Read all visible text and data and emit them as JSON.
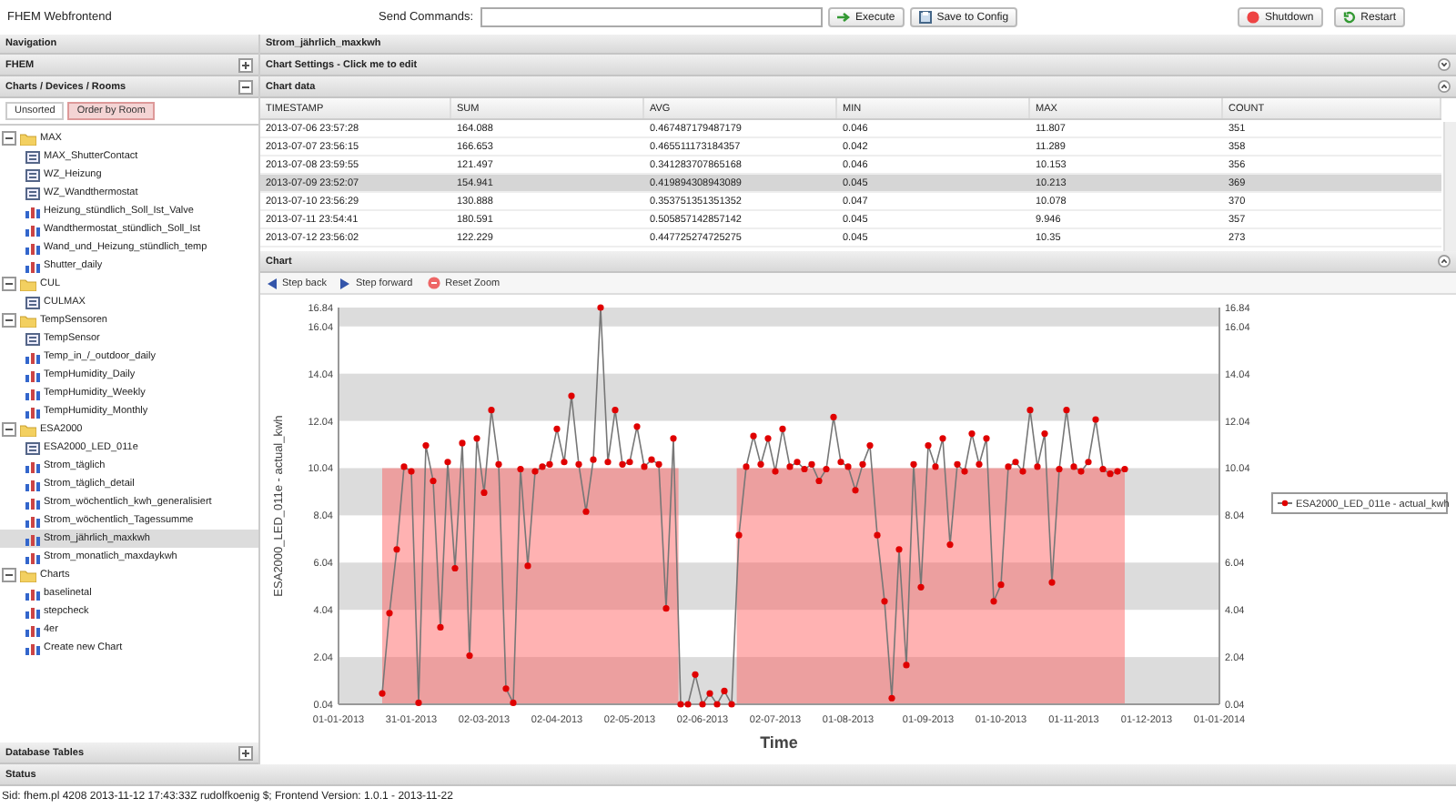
{
  "app": {
    "title": "FHEM Webfrontend"
  },
  "command": {
    "label": "Send Commands:",
    "buttons": [
      {
        "label": "Execute",
        "kind": "execute"
      },
      {
        "label": "Save to Config",
        "kind": "save"
      }
    ]
  },
  "power_buttons": [
    {
      "label": "Shutdown",
      "kind": "shutdown"
    },
    {
      "label": "Restart",
      "kind": "restart"
    }
  ],
  "navigation": {
    "title": "Navigation",
    "sections": [
      {
        "title": "FHEM",
        "expanded": false
      },
      {
        "title": "Charts / Devices / Rooms",
        "expanded": true
      }
    ],
    "tabs": [
      {
        "label": "Unsorted",
        "selected": false
      },
      {
        "label": "Order by Room",
        "selected": true
      }
    ],
    "tree": [
      {
        "label": "MAX",
        "expanded": true,
        "children": [
          {
            "label": "MAX_ShutterContact",
            "kind": "device",
            "selected": false
          },
          {
            "label": "WZ_Heizung",
            "kind": "device",
            "selected": false
          },
          {
            "label": "WZ_Wandthermostat",
            "kind": "device",
            "selected": false
          },
          {
            "label": "Heizung_stündlich_Soll_Ist_Valve",
            "kind": "chart",
            "selected": false
          },
          {
            "label": "Wandthermostat_stündlich_Soll_Ist",
            "kind": "chart",
            "selected": false
          },
          {
            "label": "Wand_und_Heizung_stündlich_temp",
            "kind": "chart",
            "selected": false
          },
          {
            "label": "Shutter_daily",
            "kind": "chart",
            "selected": false
          }
        ]
      },
      {
        "label": "CUL",
        "expanded": true,
        "children": [
          {
            "label": "CULMAX",
            "kind": "device",
            "selected": false
          }
        ]
      },
      {
        "label": "TempSensoren",
        "expanded": true,
        "children": [
          {
            "label": "TempSensor",
            "kind": "device",
            "selected": false
          },
          {
            "label": "Temp_in_/_outdoor_daily",
            "kind": "chart",
            "selected": false
          },
          {
            "label": "TempHumidity_Daily",
            "kind": "chart",
            "selected": false
          },
          {
            "label": "TempHumidity_Weekly",
            "kind": "chart",
            "selected": false
          },
          {
            "label": "TempHumidity_Monthly",
            "kind": "chart",
            "selected": false
          }
        ]
      },
      {
        "label": "ESA2000",
        "expanded": true,
        "children": [
          {
            "label": "ESA2000_LED_011e",
            "kind": "device",
            "selected": false
          },
          {
            "label": "Strom_täglich",
            "kind": "chart",
            "selected": false
          },
          {
            "label": "Strom_täglich_detail",
            "kind": "chart",
            "selected": false
          },
          {
            "label": "Strom_wöchentlich_kwh_generalisiert",
            "kind": "chart",
            "selected": false
          },
          {
            "label": "Strom_wöchentlich_Tagessumme",
            "kind": "chart",
            "selected": false
          },
          {
            "label": "Strom_jährlich_maxkwh",
            "kind": "chart",
            "selected": true
          },
          {
            "label": "Strom_monatlich_maxdaykwh",
            "kind": "chart",
            "selected": false
          }
        ]
      },
      {
        "label": "Charts",
        "expanded": true,
        "children": [
          {
            "label": "baselinetal",
            "kind": "chart",
            "selected": false
          },
          {
            "label": "stepcheck",
            "kind": "chart",
            "selected": false
          },
          {
            "label": "4er",
            "kind": "chart",
            "selected": false
          },
          {
            "label": "Create new Chart",
            "kind": "chart",
            "selected": false
          }
        ]
      }
    ],
    "footer": {
      "title": "Database Tables",
      "expanded": false
    }
  },
  "main": {
    "title": "Strom_jährlich_maxkwh",
    "settings": {
      "title": "Chart Settings - Click me to edit",
      "expanded": false
    },
    "data": {
      "title": "Chart data",
      "expanded": true,
      "columns": [
        "TIMESTAMP",
        "SUM",
        "AVG",
        "MIN",
        "MAX",
        "COUNT"
      ],
      "rows": [
        {
          "cells": [
            "2013-07-06 23:57:28",
            "164.088",
            "0.467487179487179",
            "0.046",
            "11.807",
            "351"
          ],
          "selected": false
        },
        {
          "cells": [
            "2013-07-07 23:56:15",
            "166.653",
            "0.465511173184357",
            "0.042",
            "11.289",
            "358"
          ],
          "selected": false
        },
        {
          "cells": [
            "2013-07-08 23:59:55",
            "121.497",
            "0.341283707865168",
            "0.046",
            "10.153",
            "356"
          ],
          "selected": false
        },
        {
          "cells": [
            "2013-07-09 23:52:07",
            "154.941",
            "0.419894308943089",
            "0.045",
            "10.213",
            "369"
          ],
          "selected": true
        },
        {
          "cells": [
            "2013-07-10 23:56:29",
            "130.888",
            "0.353751351351352",
            "0.047",
            "10.078",
            "370"
          ],
          "selected": false
        },
        {
          "cells": [
            "2013-07-11 23:54:41",
            "180.591",
            "0.505857142857142",
            "0.045",
            "9.946",
            "357"
          ],
          "selected": false
        },
        {
          "cells": [
            "2013-07-12 23:56:02",
            "122.229",
            "0.447725274725275",
            "0.045",
            "10.35",
            "273"
          ],
          "selected": false
        }
      ]
    },
    "chart": {
      "title": "Chart",
      "expanded": true,
      "tools": [
        {
          "label": "Step back",
          "kind": "back"
        },
        {
          "label": "Step forward",
          "kind": "forward"
        },
        {
          "label": "Reset Zoom",
          "kind": "reset"
        }
      ],
      "chart_data": {
        "type": "line",
        "xlabel": "Time",
        "ylabel": "ESA2000_LED_011e - actual_kwh",
        "categories": [
          "01-01-2013",
          null,
          null,
          null,
          null,
          null,
          null,
          null,
          null,
          null,
          "31-01-2013",
          null,
          null,
          null,
          null,
          null,
          null,
          null,
          null,
          null,
          "02-03-2013",
          null,
          null,
          null,
          null,
          null,
          null,
          null,
          null,
          null,
          "02-04-2013",
          null,
          null,
          null,
          null,
          null,
          null,
          null,
          null,
          null,
          "02-05-2013",
          null,
          null,
          null,
          null,
          null,
          null,
          null,
          null,
          null,
          "02-06-2013",
          null,
          null,
          null,
          null,
          null,
          null,
          null,
          null,
          null,
          "02-07-2013",
          null,
          null,
          null,
          null,
          null,
          null,
          null,
          null,
          null,
          "01-08-2013",
          null,
          null,
          null,
          null,
          null,
          null,
          null,
          null,
          null,
          null,
          "01-09-2013",
          null,
          null,
          null,
          null,
          null,
          null,
          null,
          null,
          null,
          "01-10-2013",
          null,
          null,
          null,
          null,
          null,
          null,
          null,
          null,
          null,
          "01-11-2013",
          null,
          null,
          null,
          null,
          null,
          null,
          null,
          null,
          null,
          "01-12-2013",
          null,
          null,
          null,
          null,
          null,
          null,
          null,
          null,
          null,
          "01-01-2014"
        ],
        "series": [
          {
            "name": "ESA2000_LED_011e - actual_kwh",
            "color": "#e00000",
            "marker": true,
            "values": [
              null,
              null,
              null,
              null,
              null,
              null,
              0.5,
              3.9,
              6.6,
              10.1,
              9.9,
              0.1,
              11.0,
              9.5,
              3.3,
              10.3,
              5.8,
              11.1,
              2.1,
              11.3,
              9.0,
              12.5,
              10.2,
              0.7,
              0.1,
              10.0,
              5.9,
              9.9,
              10.1,
              10.2,
              11.7,
              10.3,
              13.1,
              10.2,
              8.2,
              10.4,
              16.84,
              10.3,
              12.5,
              10.2,
              10.3,
              11.8,
              10.1,
              10.4,
              10.2,
              4.1,
              11.3,
              0.04,
              0.04,
              1.3,
              0.04,
              0.5,
              0.04,
              0.6,
              0.04,
              7.2,
              10.1,
              11.4,
              10.2,
              11.3,
              9.9,
              11.7,
              10.1,
              10.3,
              10.0,
              10.2,
              9.5,
              10.0,
              12.2,
              10.3,
              10.1,
              9.1,
              10.2,
              11.0,
              7.2,
              4.4,
              0.3,
              6.6,
              1.7,
              10.2,
              5.0,
              11.0,
              10.1,
              11.3,
              6.8,
              10.2,
              9.9,
              11.5,
              10.2,
              11.3,
              4.4,
              5.1,
              10.1,
              10.3,
              9.9,
              12.5,
              10.1,
              11.5,
              5.2,
              10.0,
              12.5,
              10.1,
              9.9,
              10.3,
              12.1,
              10.0,
              9.8,
              9.9,
              10.0,
              null,
              null,
              null,
              null,
              null,
              null,
              null,
              null,
              null,
              null,
              null,
              null,
              null
            ]
          }
        ],
        "ylim": [
          0.04,
          16.84
        ],
        "yticks": [
          0.04,
          2.04,
          4.04,
          6.04,
          8.04,
          10.04,
          12.04,
          14.04,
          16.04,
          16.84
        ]
      },
      "right_axis_labels": [
        "16.84",
        "16.04",
        "14.04",
        "12.04",
        "10.04",
        "8.04",
        "6.04",
        "4.04",
        "2.04",
        "0.04"
      ]
    }
  },
  "status": {
    "title": "Status",
    "text": "Sid: fhem.pl 4208 2013-11-12 17:43:33Z rudolfkoenig $; Frontend Version: 1.0.1 - 2013-11-22"
  }
}
